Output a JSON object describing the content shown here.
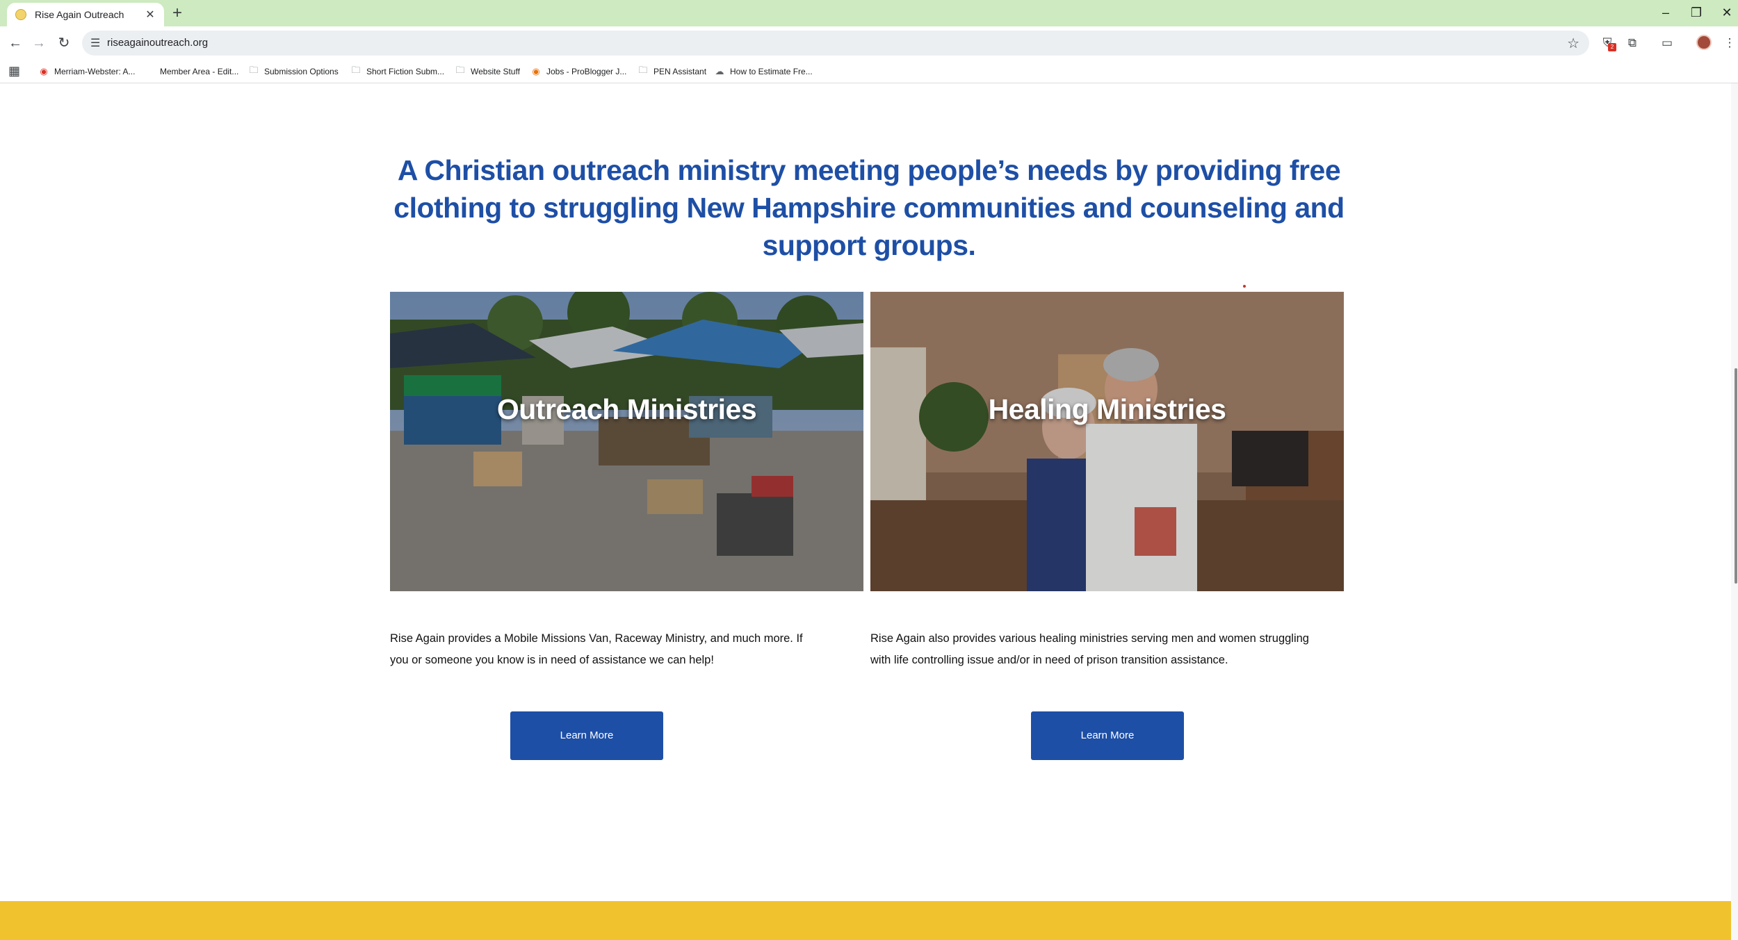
{
  "browser": {
    "tab_title": "Rise Again Outreach",
    "tab_close": "✕",
    "new_tab": "+",
    "url": "riseagainoutreach.org",
    "window_controls": {
      "minimize": "–",
      "restore": "❐",
      "close": "✕"
    },
    "extension_badge": "2"
  },
  "bookmarks": [
    {
      "label": "Merriam-Webster: A...",
      "icon": "mw-icon"
    },
    {
      "label": "Member Area - Edit...",
      "icon": "blank-icon"
    },
    {
      "label": "Submission Options",
      "icon": "folder-icon"
    },
    {
      "label": "Short Fiction Subm...",
      "icon": "folder-icon"
    },
    {
      "label": "Website Stuff",
      "icon": "folder-icon"
    },
    {
      "label": "Jobs - ProBlogger J...",
      "icon": "problogger-icon"
    },
    {
      "label": "PEN Assistant",
      "icon": "folder-icon"
    },
    {
      "label": "How to Estimate Fre...",
      "icon": "cloud-icon"
    }
  ],
  "main": {
    "tagline": "A Christian outreach ministry meeting people’s needs by providing free clothing to struggling New Hampshire communities and counseling and support groups.",
    "cards": [
      {
        "title": "Outreach Ministries",
        "description": "Rise Again provides a Mobile Missions Van, Raceway Ministry, and much more. If you or someone you know is in need of assistance we can help!",
        "button": "Learn More"
      },
      {
        "title": "Healing Ministries",
        "description": "Rise Again also provides various healing ministries serving men and women struggling with life controlling issue and/or in need of prison transition assistance.",
        "button": "Learn More"
      }
    ]
  },
  "colors": {
    "brand_blue": "#1e4fa6",
    "footer_yellow": "#f0c22e",
    "tabstrip_green": "#cdeac0"
  }
}
